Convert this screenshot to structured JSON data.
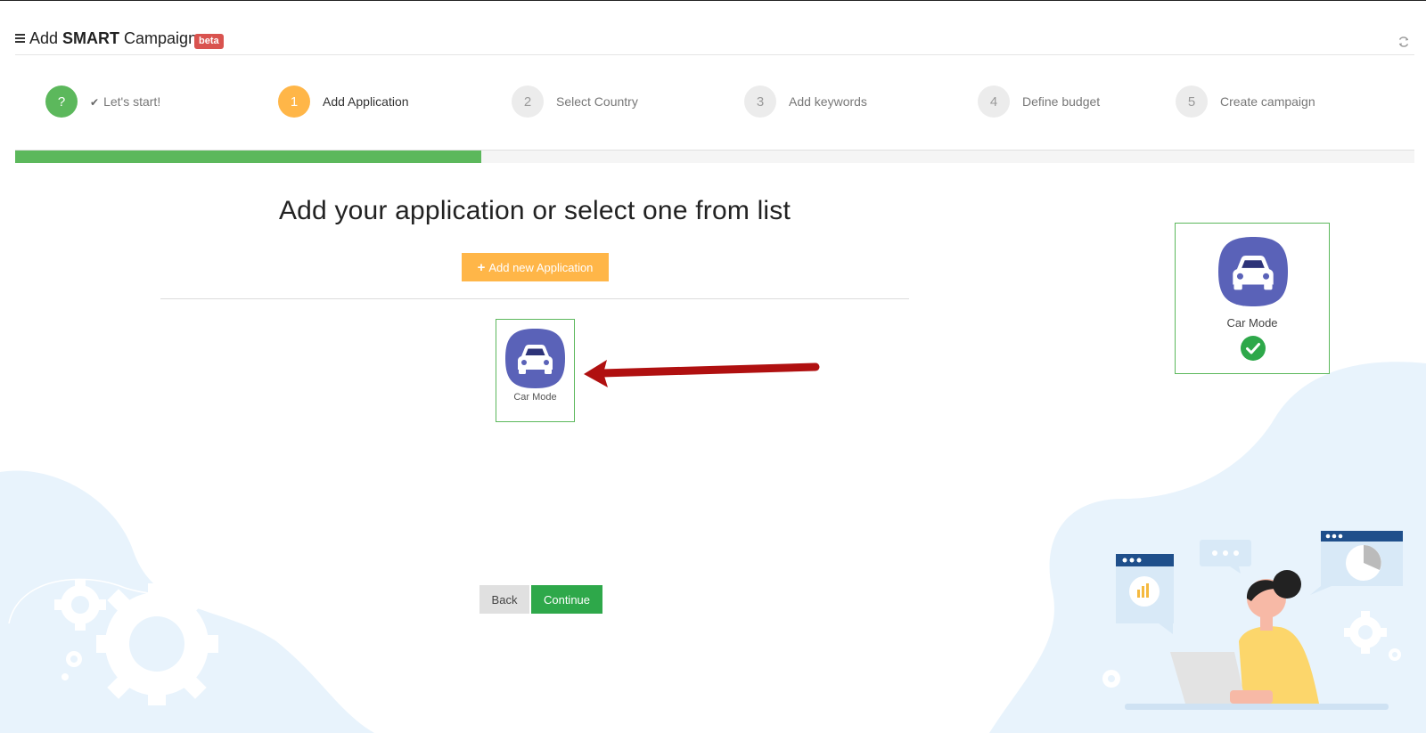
{
  "header": {
    "title_prefix": "Add ",
    "title_bold": "SMART",
    "title_suffix": " Campaign",
    "badge": "beta"
  },
  "steps": [
    {
      "number": "?",
      "label": "Let's start!",
      "state": "done"
    },
    {
      "number": "1",
      "label": "Add Application",
      "state": "active"
    },
    {
      "number": "2",
      "label": "Select Country",
      "state": "pending"
    },
    {
      "number": "3",
      "label": "Add keywords",
      "state": "pending"
    },
    {
      "number": "4",
      "label": "Define budget",
      "state": "pending"
    },
    {
      "number": "5",
      "label": "Create campaign",
      "state": "pending"
    }
  ],
  "progress": {
    "fraction": 0.333
  },
  "main": {
    "title": "Add your application or select one from list",
    "add_button": "Add new Application"
  },
  "apps": [
    {
      "name": "Car Mode",
      "icon": "car-icon"
    }
  ],
  "selected_app": {
    "name": "Car Mode",
    "icon": "car-icon"
  },
  "buttons": {
    "back": "Back",
    "continue": "Continue"
  },
  "colors": {
    "success": "#5cb85c",
    "accent": "#ffb648",
    "badge": "#d9534f",
    "app_icon_bg": "#5a62b8",
    "continue": "#2ea84a",
    "arrow": "#b01010"
  }
}
